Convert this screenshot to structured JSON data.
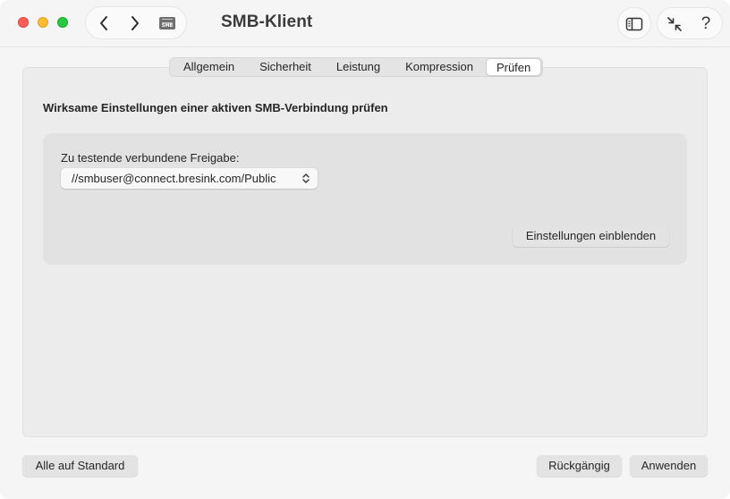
{
  "window": {
    "title": "SMB-Klient"
  },
  "toolbar": {
    "back_icon": "chevron-left-icon",
    "forward_icon": "chevron-right-icon",
    "drive_icon": "network-drive-icon",
    "drive_label": "SMB",
    "sidebar_icon": "sidebar-toggle-icon",
    "collapse_icon": "collapse-arrows-icon",
    "help_label": "?"
  },
  "tabs": [
    {
      "label": "Allgemein",
      "active": false
    },
    {
      "label": "Sicherheit",
      "active": false
    },
    {
      "label": "Leistung",
      "active": false
    },
    {
      "label": "Kompression",
      "active": false
    },
    {
      "label": "Prüfen",
      "active": true
    }
  ],
  "main": {
    "heading": "Wirksame Einstellungen einer aktiven SMB-Verbindung prüfen",
    "share_label": "Zu testende verbundene Freigabe:",
    "share_value": "//smbuser@connect.bresink.com/Public",
    "show_settings_button": "Einstellungen einblenden"
  },
  "footer": {
    "defaults_button": "Alle auf Standard",
    "undo_button": "Rückgängig",
    "apply_button": "Anwenden"
  },
  "colors": {
    "close": "#ff5f57",
    "minimize": "#febc2e",
    "maximize": "#28c840",
    "window_bg": "#f5f5f5",
    "panel_bg": "#ececec"
  }
}
